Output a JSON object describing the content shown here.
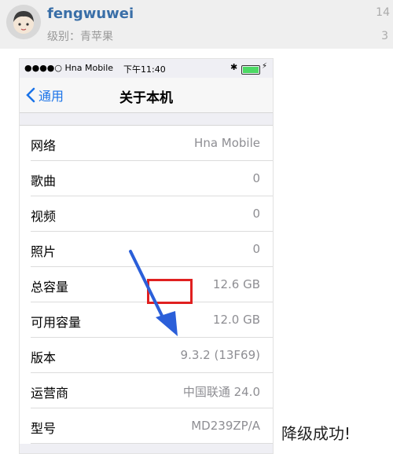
{
  "post": {
    "username": "fengwuwei",
    "level": "级别：青苹果",
    "stat_top": "14",
    "stat_bottom": "3"
  },
  "phone": {
    "status": {
      "signal": "●●●●○ Hna Mobile",
      "time": "下午11:40"
    },
    "nav": {
      "back_label": "通用",
      "title": "关于本机"
    },
    "rows": [
      {
        "label": "网络",
        "value": "Hna Mobile"
      },
      {
        "label": "歌曲",
        "value": "0"
      },
      {
        "label": "视频",
        "value": "0"
      },
      {
        "label": "照片",
        "value": "0"
      },
      {
        "label": "总容量",
        "value": "12.6 GB"
      },
      {
        "label": "可用容量",
        "value": "12.0 GB"
      },
      {
        "label": "版本",
        "value": "9.3.2 (13F69)"
      },
      {
        "label": "运营商",
        "value": "中国联通 24.0"
      },
      {
        "label": "型号",
        "value": "MD239ZP/A"
      }
    ]
  },
  "caption": "降级成功!",
  "colors": {
    "accent": "#1a73e8",
    "highlight": "#e02020",
    "arrow": "#2b5fd9"
  }
}
